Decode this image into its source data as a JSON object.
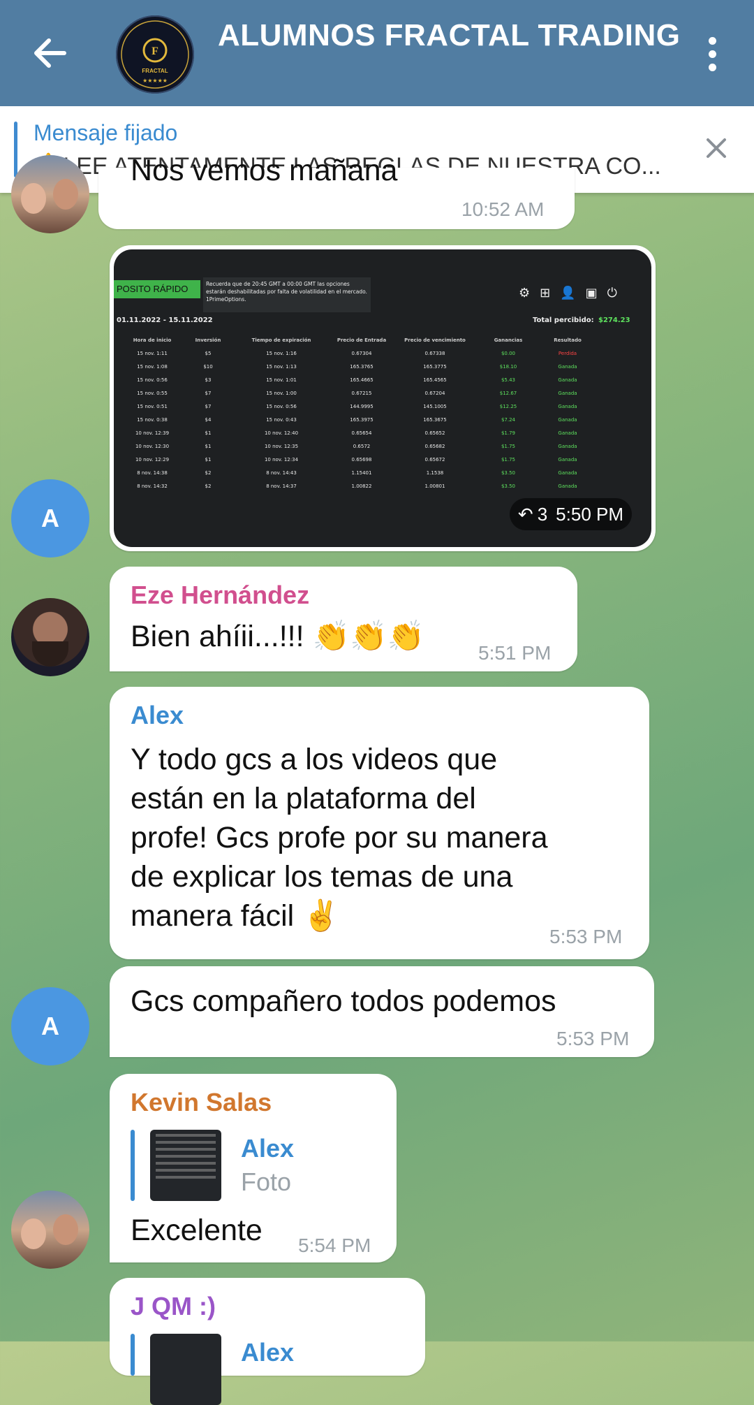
{
  "header": {
    "title": "ALUMNOS FRACTAL TRADING",
    "avatar_label": "FRACTAL",
    "accent": "#517da2"
  },
  "pinned": {
    "title": "Mensaje fijado",
    "text": "⚠️LEE ATENTAMENTE LAS REGLAS DE NUESTRA CO..."
  },
  "messages": {
    "m0": {
      "text": "Nos vemos mañana",
      "time": "10:52 AM"
    },
    "m1": {
      "time": "5:50 PM",
      "forwards": "3",
      "avatar_letter": "A",
      "photo": {
        "deposit_btn": "POSITO RÁPIDO",
        "notice": "Recuerda que de 20:45 GMT a 00:00 GMT las opciones estarán deshabilitadas por falta de volatilidad en el mercado. 1PrimeOptions.",
        "date_range": "01.11.2022 - 15.11.2022",
        "total_label": "Total percibido:",
        "total_value": "$274.23",
        "columns": [
          "Hora de inicio",
          "Inversión",
          "Tiempo de expiración",
          "Precio de Entrada",
          "Precio de vencimiento",
          "Ganancias",
          "Resultado"
        ],
        "rows": [
          [
            "15 nov. 1:11",
            "$5",
            "15 nov. 1:16",
            "0.67304",
            "0.67338",
            "$0.00",
            "Perdida"
          ],
          [
            "15 nov. 1:08",
            "$10",
            "15 nov. 1:13",
            "165.3765",
            "165.3775",
            "$18.10",
            "Ganada"
          ],
          [
            "15 nov. 0:56",
            "$3",
            "15 nov. 1:01",
            "165.4665",
            "165.4565",
            "$5.43",
            "Ganada"
          ],
          [
            "15 nov. 0:55",
            "$7",
            "15 nov. 1:00",
            "0.67215",
            "0.67204",
            "$12.67",
            "Ganada"
          ],
          [
            "15 nov. 0:51",
            "$7",
            "15 nov. 0:56",
            "144.9995",
            "145.1005",
            "$12.25",
            "Ganada"
          ],
          [
            "15 nov. 0:38",
            "$4",
            "15 nov. 0:43",
            "165.3975",
            "165.3675",
            "$7.24",
            "Ganada"
          ],
          [
            "10 nov. 12:39",
            "$1",
            "10 nov. 12:40",
            "0.65654",
            "0.65652",
            "$1.79",
            "Ganada"
          ],
          [
            "10 nov. 12:30",
            "$1",
            "10 nov. 12:35",
            "0.6572",
            "0.65682",
            "$1.75",
            "Ganada"
          ],
          [
            "10 nov. 12:29",
            "$1",
            "10 nov. 12:34",
            "0.65698",
            "0.65672",
            "$1.75",
            "Ganada"
          ],
          [
            "8 nov. 14:38",
            "$2",
            "8 nov. 14:43",
            "1.15401",
            "1.1538",
            "$3.50",
            "Ganada"
          ],
          [
            "8 nov. 14:32",
            "$2",
            "8 nov. 14:37",
            "1.00822",
            "1.00801",
            "$3.50",
            "Ganada"
          ]
        ]
      }
    },
    "m2": {
      "sender": "Eze Hernández",
      "text": "Bien ahíii...!!! 👏👏👏",
      "time": "5:51 PM",
      "color": "#d14f8e"
    },
    "m3": {
      "sender": "Alex",
      "lines": [
        "Y todo gcs a los videos que",
        "están en la plataforma del",
        "profe! Gcs profe por su manera",
        "de explicar los temas de una",
        "manera fácil ✌️"
      ],
      "time": "5:53 PM",
      "color": "#3a8bd0"
    },
    "m4": {
      "text": "Gcs compañero todos podemos",
      "time": "5:53 PM",
      "avatar_letter": "A"
    },
    "m5": {
      "sender": "Kevin Salas",
      "reply_name": "Alex",
      "reply_text": "Foto",
      "text": "Excelente",
      "time": "5:54 PM",
      "color": "#d1772e"
    },
    "m6": {
      "sender": "J QM :)",
      "reply_name": "Alex",
      "color": "#9a55c8"
    }
  }
}
